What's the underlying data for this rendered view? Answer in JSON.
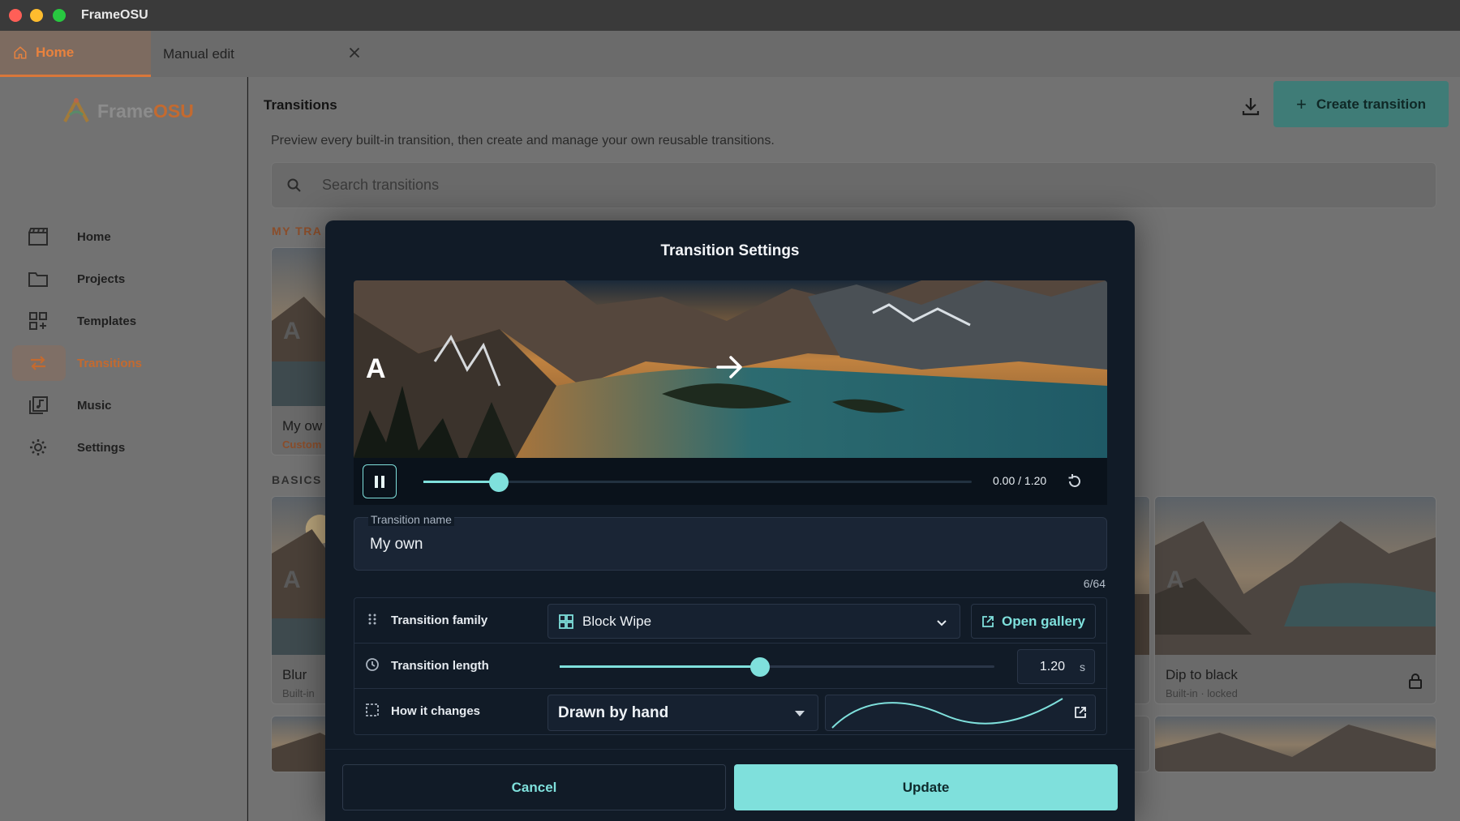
{
  "app": {
    "title": "FrameOSU"
  },
  "tabs": [
    {
      "label": "Home",
      "icon": "home-icon",
      "active": true
    },
    {
      "label": "Manual edit",
      "icon": "close-icon",
      "active": false
    }
  ],
  "brand": {
    "name_part1": "Frame",
    "name_part2": "OSU"
  },
  "sidebar": {
    "items": [
      {
        "label": "Home",
        "icon": "clapperboard-icon"
      },
      {
        "label": "Projects",
        "icon": "folder-icon"
      },
      {
        "label": "Templates",
        "icon": "grid-plus-icon"
      },
      {
        "label": "Transitions",
        "icon": "swap-arrows-icon",
        "active": true
      },
      {
        "label": "Music",
        "icon": "music-library-icon"
      },
      {
        "label": "Settings",
        "icon": "gear-icon"
      }
    ]
  },
  "main": {
    "title": "Transitions",
    "subtitle": "Preview every built-in transition, then create and manage your own reusable transitions.",
    "create_label": "Create transition",
    "search_placeholder": "Search transitions",
    "sections": {
      "mine": "MY TRA",
      "basics": "BASICS"
    },
    "cards": [
      {
        "letter": "A",
        "title": "My ow",
        "subtitle": "Custom"
      },
      {
        "letter": "A",
        "title": "Blur",
        "subtitle": "Built-in"
      },
      {
        "letter": "A",
        "title": "Dip to black",
        "subtitle": "Built-in · locked"
      }
    ]
  },
  "modal": {
    "title": "Transition Settings",
    "preview": {
      "letter": "A",
      "progress": 0.137
    },
    "player": {
      "time": "0.00 / 1.20"
    },
    "name_label": "Transition name",
    "name_value": "My own",
    "char_count": "6/64",
    "rows": {
      "family": {
        "label": "Transition family",
        "value": "Block Wipe",
        "gallery_label": "Open gallery"
      },
      "length": {
        "label": "Transition length",
        "value": "1.20",
        "unit": "s",
        "fraction": 0.46
      },
      "changes": {
        "label": "How it changes",
        "value": "Drawn by hand"
      }
    },
    "cancel_label": "Cancel",
    "update_label": "Update"
  },
  "colors": {
    "accent": "#7fe0dc",
    "brand_orange": "#c46a2f",
    "modal_bg": "#111b27"
  }
}
